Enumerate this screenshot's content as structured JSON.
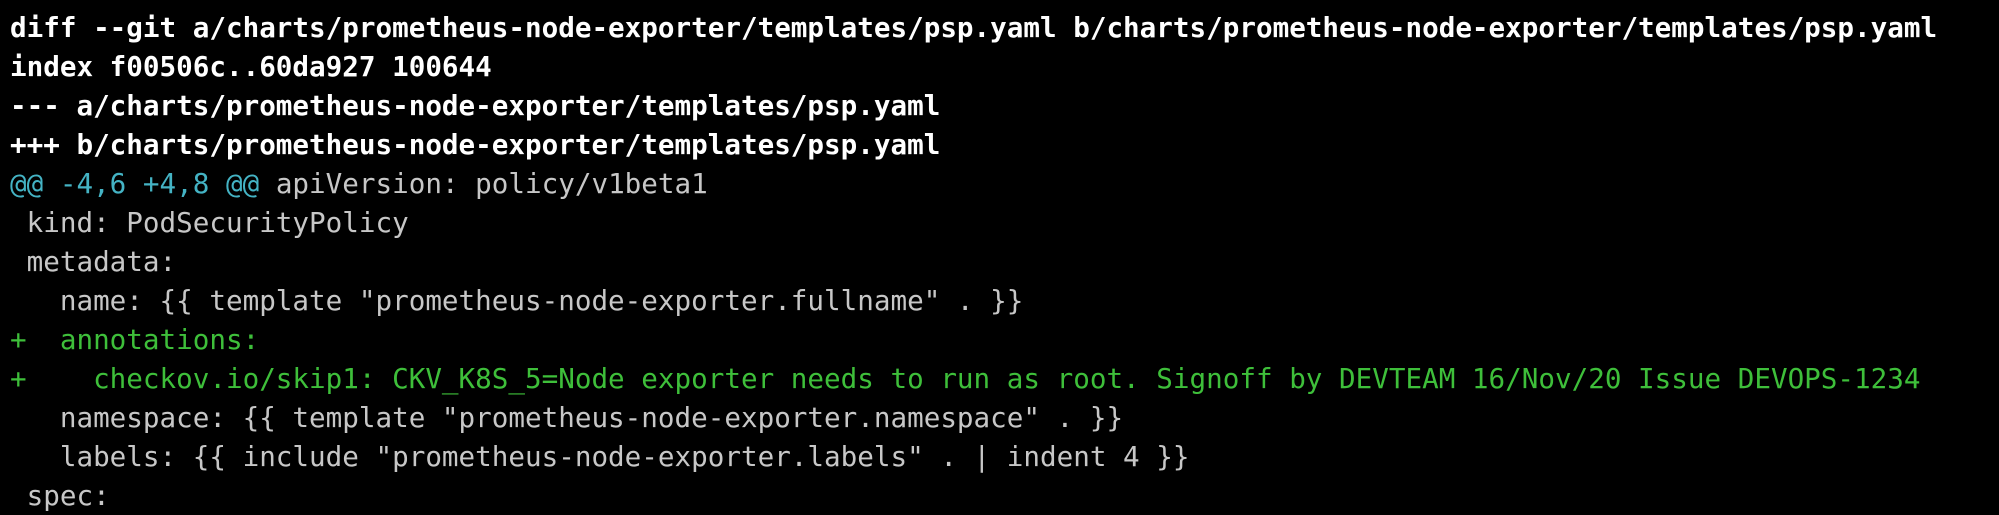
{
  "colors": {
    "background": "#000000",
    "header_text": "#ffffff",
    "hunk_marker": "#44b3c4",
    "context_text": "#c7c7c7",
    "added_text": "#3ebf3a"
  },
  "diff": {
    "header": {
      "diff_cmd": "diff --git a/charts/prometheus-node-exporter/templates/psp.yaml b/charts/prometheus-node-exporter/templates/psp.yaml",
      "index": "index f00506c..60da927 100644",
      "old_file": "--- a/charts/prometheus-node-exporter/templates/psp.yaml",
      "new_file": "+++ b/charts/prometheus-node-exporter/templates/psp.yaml"
    },
    "hunk": {
      "range": "@@ -4,6 +4,8 @@",
      "context": " apiVersion: policy/v1beta1"
    },
    "lines": [
      {
        "kind": "context",
        "text": " kind: PodSecurityPolicy"
      },
      {
        "kind": "context",
        "text": " metadata:"
      },
      {
        "kind": "context",
        "text": "   name: {{ template \"prometheus-node-exporter.fullname\" . }}"
      },
      {
        "kind": "added",
        "text": "+  annotations:"
      },
      {
        "kind": "added",
        "text": "+    checkov.io/skip1: CKV_K8S_5=Node exporter needs to run as root. Signoff by DEVTEAM 16/Nov/20 Issue DEVOPS-1234"
      },
      {
        "kind": "context",
        "text": "   namespace: {{ template \"prometheus-node-exporter.namespace\" . }}"
      },
      {
        "kind": "context",
        "text": "   labels: {{ include \"prometheus-node-exporter.labels\" . | indent 4 }}"
      },
      {
        "kind": "context",
        "text": " spec:"
      }
    ]
  }
}
